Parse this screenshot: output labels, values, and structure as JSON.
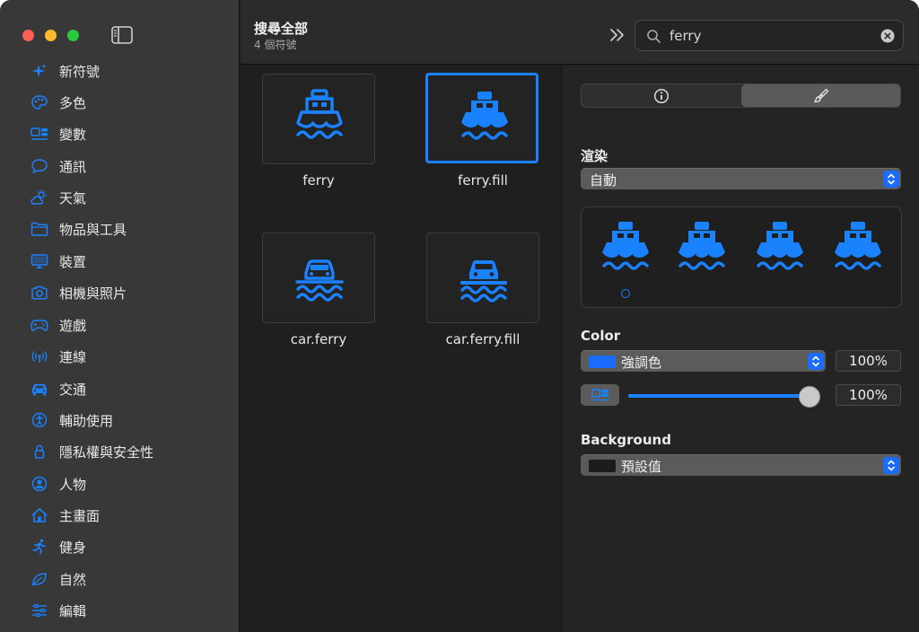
{
  "window": {
    "colors": {
      "accent": "#1a82ff",
      "sidebar": "#383838",
      "content": "#1f1f1f"
    }
  },
  "sidebar": {
    "toggle_icon": "sidebar-toggle-icon",
    "items": [
      {
        "label": "新符號",
        "icon": "sparkle-icon"
      },
      {
        "label": "多色",
        "icon": "palette-icon"
      },
      {
        "label": "變數",
        "icon": "variable-icon"
      },
      {
        "label": "通訊",
        "icon": "message-bubble-icon"
      },
      {
        "label": "天氣",
        "icon": "cloud-sun-icon"
      },
      {
        "label": "物品與工具",
        "icon": "folder-icon"
      },
      {
        "label": "裝置",
        "icon": "display-icon"
      },
      {
        "label": "相機與照片",
        "icon": "camera-icon"
      },
      {
        "label": "遊戲",
        "icon": "gamecontroller-icon"
      },
      {
        "label": "連線",
        "icon": "antenna-icon"
      },
      {
        "label": "交通",
        "icon": "car-icon"
      },
      {
        "label": "輔助使用",
        "icon": "accessibility-icon"
      },
      {
        "label": "隱私權與安全性",
        "icon": "lock-icon"
      },
      {
        "label": "人物",
        "icon": "person-circle-icon"
      },
      {
        "label": "主畫面",
        "icon": "house-icon"
      },
      {
        "label": "健身",
        "icon": "figure-run-icon"
      },
      {
        "label": "自然",
        "icon": "leaf-icon"
      },
      {
        "label": "編輯",
        "icon": "sliders-icon"
      }
    ]
  },
  "toolbar": {
    "title": "搜尋全部",
    "subtitle": "4 個符號",
    "more_icon": "chevron-double-right-icon",
    "search": {
      "value": "ferry",
      "icon": "magnifyingglass-icon",
      "clear_icon": "clear-icon"
    }
  },
  "grid": {
    "selected_index": 1,
    "symbols": [
      {
        "label": "ferry",
        "icon": "ferry-icon"
      },
      {
        "label": "ferry.fill",
        "icon": "ferry-fill-icon"
      },
      {
        "label": "car.ferry",
        "icon": "car-ferry-icon"
      },
      {
        "label": "car.ferry.fill",
        "icon": "car-ferry-fill-icon"
      }
    ]
  },
  "inspector": {
    "segments": [
      {
        "icon": "info-icon",
        "selected": false
      },
      {
        "icon": "paintbrush-icon",
        "selected": true
      }
    ],
    "rendering": {
      "label": "渲染",
      "value": "自動"
    },
    "preview_variant_count": 4,
    "color": {
      "label": "Color",
      "value": "強調色",
      "swatch": "#1a6cff",
      "opacity": "100%",
      "slider_value": "100%",
      "slider_fraction": 1.0
    },
    "background": {
      "label": "Background",
      "value": "預設值",
      "swatch": "#1c1c1c"
    }
  }
}
